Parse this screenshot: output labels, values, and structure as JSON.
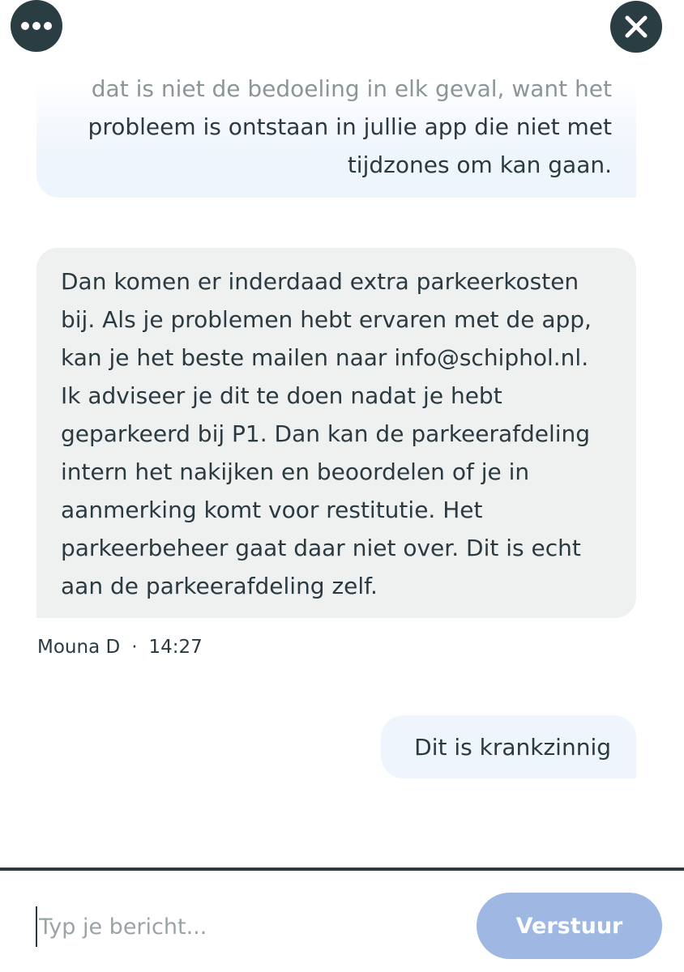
{
  "header": {
    "menu_icon": "more-horizontal-icon",
    "close_icon": "close-icon"
  },
  "messages": [
    {
      "role": "user",
      "lines": [
        "dat is niet de bedoeling in elk geval, want het",
        "probleem is ontstaan in jullie app die niet met",
        "tijdzones om kan gaan."
      ]
    },
    {
      "role": "agent",
      "lines": [
        "Dan komen er inderdaad extra parkeerkosten",
        "bij. Als je problemen hebt ervaren met de app,",
        "kan je het beste mailen naar info@schiphol.nl.",
        "Ik adviseer je dit te doen nadat je hebt",
        "geparkeerd bij P1. Dan kan de parkeerafdeling",
        "intern het nakijken en beoordelen of je in",
        "aanmerking komt voor restitutie. Het",
        "parkeerbeheer gaat daar niet over. Dit is echt",
        "aan de parkeerafdeling zelf."
      ],
      "sender": "Mouna D",
      "separator": "·",
      "time": "14:27"
    },
    {
      "role": "user",
      "text": "Dit is krankzinnig"
    }
  ],
  "composer": {
    "placeholder": "Typ je bericht...",
    "value": "",
    "send_label": "Verstuur"
  },
  "colors": {
    "icon_button_bg": "#2a3d42",
    "user_bubble_bg": "#eef5fc",
    "agent_bubble_bg": "#eff1f1",
    "send_button_bg": "#9fb7e3",
    "text": "#2b3a40"
  }
}
